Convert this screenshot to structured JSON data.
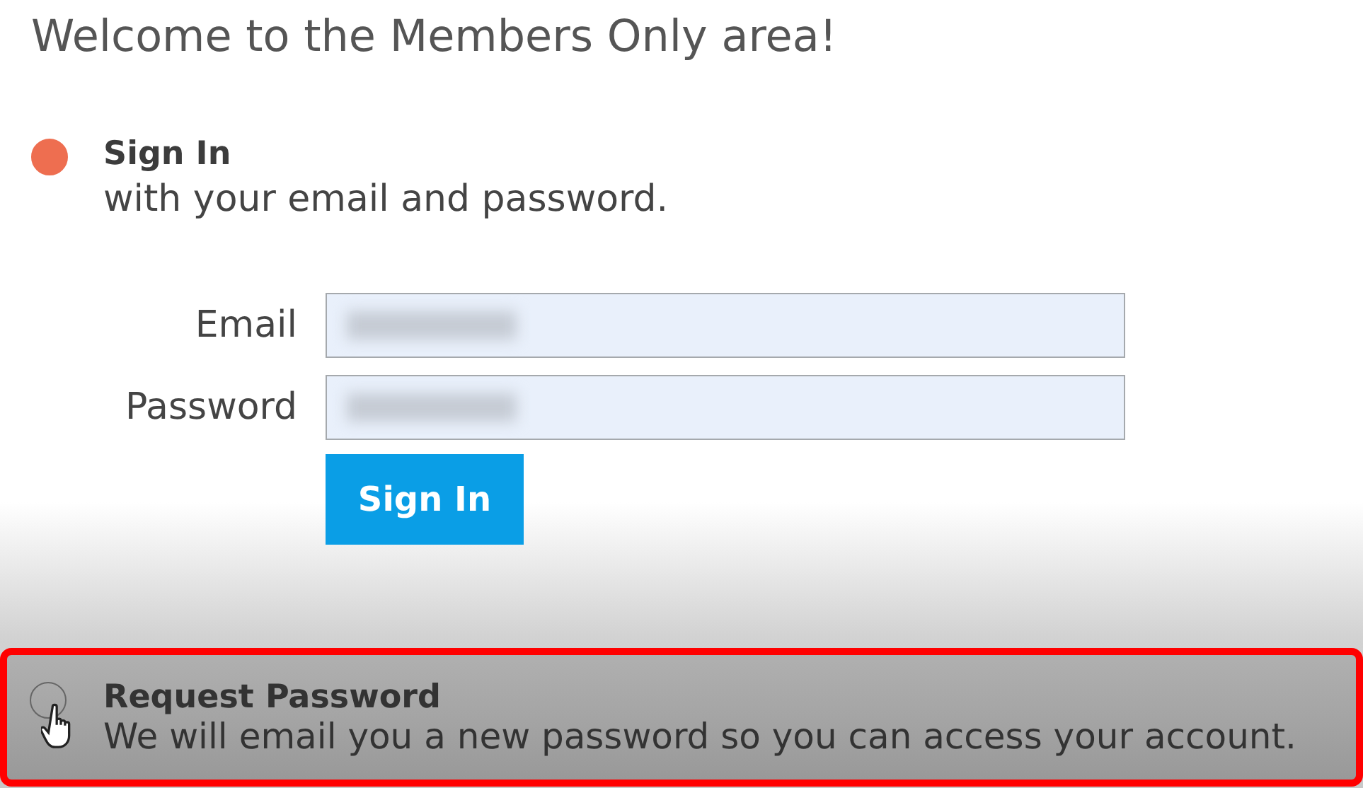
{
  "heading": "Welcome to the Members Only area!",
  "options": [
    {
      "kind": "signin",
      "title": "Sign In",
      "subtitle": "with your email and password.",
      "selected": true
    },
    {
      "kind": "request",
      "title": "Request Password",
      "subtitle": "We will email you a new password so you can access your account.",
      "selected": false,
      "highlighted": true,
      "hovered": true
    }
  ],
  "fields": [
    {
      "label": "Email",
      "value_hidden": true
    },
    {
      "label": "Password",
      "value_hidden": true
    }
  ],
  "button": "Sign In"
}
